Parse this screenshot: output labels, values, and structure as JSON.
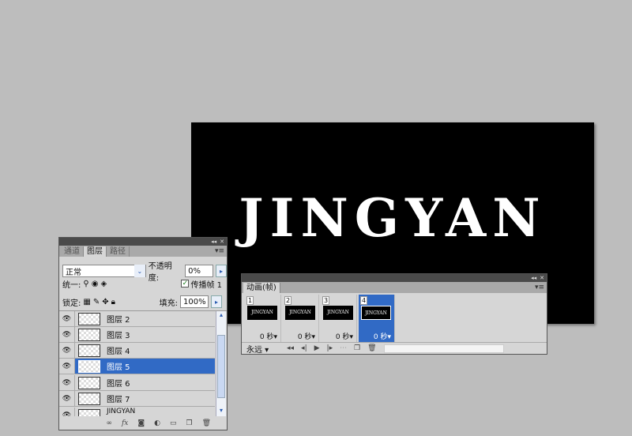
{
  "canvas": {
    "text": "JINGYAN"
  },
  "layers_panel": {
    "title_buttons": [
      "◂◂",
      "✕"
    ],
    "tabs": [
      {
        "label": "通道"
      },
      {
        "label": "图层"
      },
      {
        "label": "路径"
      }
    ],
    "blend_mode": "正常",
    "opacity_label": "不透明度:",
    "opacity_value": "0%",
    "unify_label": "统一:",
    "propagate_label": "传播帧 1",
    "propagate_checked": true,
    "lock_label": "锁定:",
    "fill_label": "填充:",
    "fill_value": "100%",
    "layers": [
      {
        "name": "图层 2"
      },
      {
        "name": "图层 3"
      },
      {
        "name": "图层 4"
      },
      {
        "name": "图层 5",
        "selected": true
      },
      {
        "name": "图层 6"
      },
      {
        "name": "图层 7"
      },
      {
        "name": "JINGYAN"
      }
    ],
    "footer_icons": [
      "link-icon",
      "fx-icon",
      "mask-icon",
      "adjustment-icon",
      "group-icon",
      "new-layer-icon",
      "trash-icon"
    ],
    "fx_label": "fx"
  },
  "animation_panel": {
    "title_buttons": [
      "◂◂",
      "✕"
    ],
    "tab": "动画(帧)",
    "frames": [
      {
        "num": "1",
        "thumb": "JINGYAN",
        "duration": "0 秒▾"
      },
      {
        "num": "2",
        "thumb": "JINGYAN",
        "duration": "0 秒▾"
      },
      {
        "num": "3",
        "thumb": "JINGYAN",
        "duration": "0 秒▾"
      },
      {
        "num": "4",
        "thumb": "JINGYAN",
        "duration": "0 秒▾",
        "selected": true
      }
    ],
    "loop": "永远",
    "controls": [
      "first-frame-icon",
      "prev-frame-icon",
      "play-icon",
      "next-frame-icon",
      "tween-icon",
      "duplicate-frame-icon",
      "trash-icon"
    ]
  },
  "colors": {
    "selection": "#316ac5",
    "background": "#bdbdbd"
  }
}
